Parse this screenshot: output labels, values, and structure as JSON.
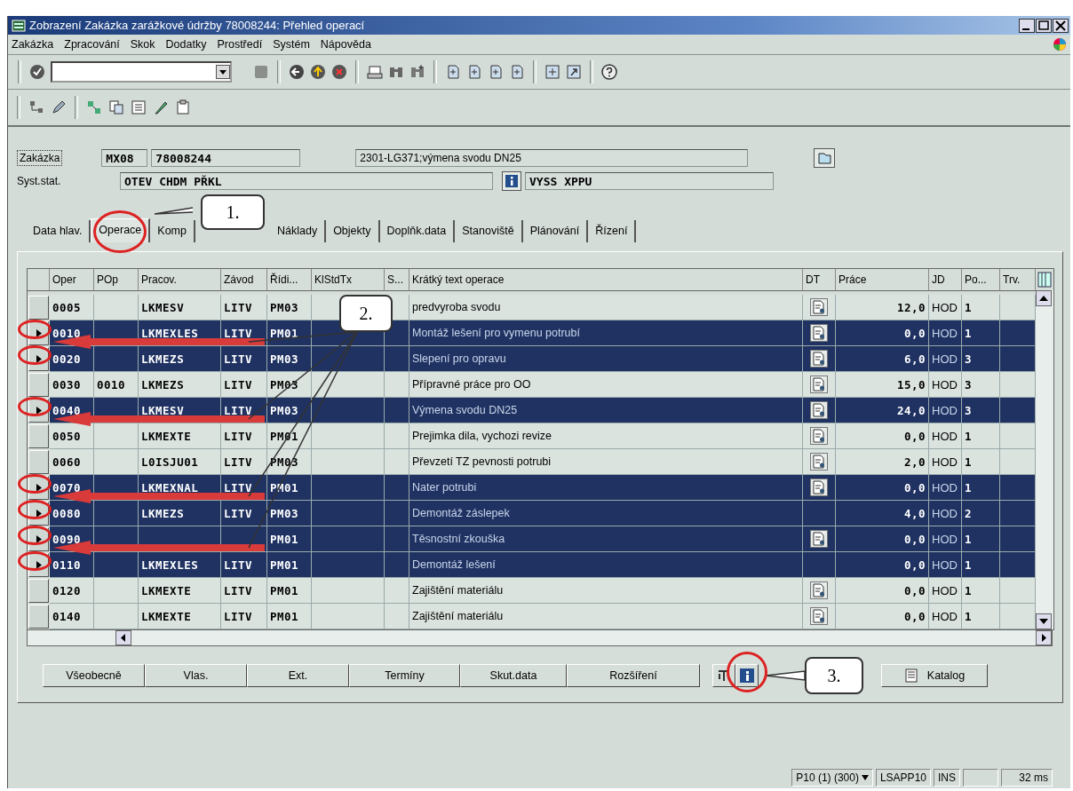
{
  "window": {
    "title": "Zobrazení Zakázka zarážkové údržby 78008244: Přehled operací"
  },
  "menu": [
    "Zakázka",
    "Zpracování",
    "Skok",
    "Dodatky",
    "Prostředí",
    "Systém",
    "Nápověda"
  ],
  "header": {
    "order_label": "Zakázka",
    "order_type": "MX08",
    "order_number": "78008244",
    "order_text": "2301-LG371;výmena svodu DN25",
    "status_label": "Syst.stat.",
    "system_status": "OTEV CHDM PŘKL",
    "user_status": "VYSS XPPU"
  },
  "tabs": [
    {
      "label": "Data hlav.",
      "selected": false
    },
    {
      "label": "Operace",
      "selected": true
    },
    {
      "label": "Komp",
      "selected": false
    },
    {
      "label": "Náklady",
      "selected": false
    },
    {
      "label": "Objekty",
      "selected": false
    },
    {
      "label": "Doplňk.data",
      "selected": false
    },
    {
      "label": "Stanoviště",
      "selected": false
    },
    {
      "label": "Plánování",
      "selected": false
    },
    {
      "label": "Řízení",
      "selected": false
    }
  ],
  "table": {
    "columns": [
      "Oper",
      "POp",
      "Pracov.",
      "Závod",
      "Řídi...",
      "KlStdTx",
      "S...",
      "Krátký text operace",
      "DT",
      "Práce",
      "JD",
      "Po...",
      "Trv."
    ],
    "rows": [
      {
        "selected": false,
        "oper": "0005",
        "pracov": "LKMESV",
        "zavod": "LITV",
        "ridi": "PM03",
        "text": "predvyroba svodu",
        "dt": true,
        "prace": "12,0",
        "jd": "HOD",
        "po": "1"
      },
      {
        "selected": true,
        "oper": "0010",
        "pracov": "LKMEXLES",
        "zavod": "LITV",
        "ridi": "PM01",
        "text": "Montáž lešení pro vymenu potrubí",
        "dt": true,
        "prace": "0,0",
        "jd": "HOD",
        "po": "1"
      },
      {
        "selected": true,
        "oper": "0020",
        "pracov": "LKMEZS",
        "zavod": "LITV",
        "ridi": "PM03",
        "text": "Slepení pro opravu",
        "dt": true,
        "prace": "6,0",
        "jd": "HOD",
        "po": "3"
      },
      {
        "selected": false,
        "oper": "0030",
        "pop": "0010",
        "pracov": "LKMEZS",
        "zavod": "LITV",
        "ridi": "PM03",
        "text": "Přípravné práce pro OO",
        "dt": true,
        "prace": "15,0",
        "jd": "HOD",
        "po": "3"
      },
      {
        "selected": true,
        "oper": "0040",
        "pracov": "LKMESV",
        "zavod": "LITV",
        "ridi": "PM03",
        "text": "Výmena svodu DN25",
        "dt": true,
        "prace": "24,0",
        "jd": "HOD",
        "po": "3"
      },
      {
        "selected": false,
        "oper": "0050",
        "pracov": "LKMEXTE",
        "zavod": "LITV",
        "ridi": "PM01",
        "text": "Prejimka dila, vychozi revize",
        "dt": true,
        "prace": "0,0",
        "jd": "HOD",
        "po": "1"
      },
      {
        "selected": false,
        "oper": "0060",
        "pracov": "L0ISJU01",
        "zavod": "LITV",
        "ridi": "PM03",
        "text": "Převzetí TZ pevnosti potrubi",
        "dt": true,
        "prace": "2,0",
        "jd": "HOD",
        "po": "1"
      },
      {
        "selected": true,
        "oper": "0070",
        "pracov": "LKMEXNAL",
        "zavod": "LITV",
        "ridi": "PM01",
        "text": "Nater potrubi",
        "dt": true,
        "prace": "0,0",
        "jd": "HOD",
        "po": "1"
      },
      {
        "selected": true,
        "oper": "0080",
        "pracov": "LKMEZS",
        "zavod": "LITV",
        "ridi": "PM03",
        "text": "Demontáž záslepek",
        "dt": false,
        "prace": "4,0",
        "jd": "HOD",
        "po": "2"
      },
      {
        "selected": true,
        "oper": "0090",
        "ridi": "PM01",
        "text": "Těsnostní zkouška",
        "dt": true,
        "prace": "0,0",
        "jd": "HOD",
        "po": "1"
      },
      {
        "selected": true,
        "oper": "0110",
        "pracov": "LKMEXLES",
        "zavod": "LITV",
        "ridi": "PM01",
        "text": "Demontáž lešení",
        "dt": false,
        "prace": "0,0",
        "jd": "HOD",
        "po": "1"
      },
      {
        "selected": false,
        "oper": "0120",
        "pracov": "LKMEXTE",
        "zavod": "LITV",
        "ridi": "PM01",
        "text": "Zajištění materiálu",
        "dt": true,
        "prace": "0,0",
        "jd": "HOD",
        "po": "1"
      },
      {
        "selected": false,
        "oper": "0140",
        "pracov": "LKMEXTE",
        "zavod": "LITV",
        "ridi": "PM01",
        "text": "Zajištění materiálu",
        "dt": true,
        "prace": "0,0",
        "jd": "HOD",
        "po": "1"
      }
    ]
  },
  "buttons": [
    "Všeobecně",
    "Vlas.",
    "Ext.",
    "Termíny",
    "Skut.data",
    "Rozšíření"
  ],
  "catalog_button": "Katalog",
  "callouts": [
    "1.",
    "2.",
    "3."
  ],
  "status_bar": {
    "system": "P10 (1) (300)",
    "server": "LSAPP10",
    "mode": "INS",
    "time": "32 ms"
  }
}
